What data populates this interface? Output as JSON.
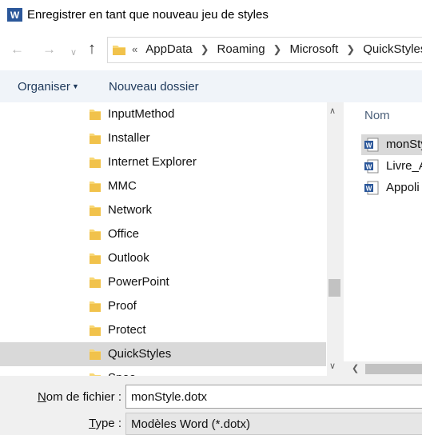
{
  "window": {
    "title": "Enregistrer en tant que nouveau jeu de styles",
    "app_icon": "word-icon"
  },
  "nav": {
    "back_icon": "arrow-left-icon",
    "forward_icon": "arrow-right-icon",
    "history_icon": "chevron-down-icon",
    "up_icon": "arrow-up-icon"
  },
  "address": {
    "overflow_marker": "«",
    "breadcrumbs": [
      "AppData",
      "Roaming",
      "Microsoft",
      "QuickStyles"
    ]
  },
  "toolbar": {
    "organise_label": "Organiser",
    "new_folder_label": "Nouveau dossier"
  },
  "tree": {
    "items": [
      {
        "label": "InputMethod"
      },
      {
        "label": "Installer"
      },
      {
        "label": "Internet Explorer"
      },
      {
        "label": "MMC"
      },
      {
        "label": "Network"
      },
      {
        "label": "Office"
      },
      {
        "label": "Outlook"
      },
      {
        "label": "PowerPoint"
      },
      {
        "label": "Proof"
      },
      {
        "label": "Protect"
      },
      {
        "label": "QuickStyles",
        "selected": true
      },
      {
        "label": "Spee"
      }
    ]
  },
  "files": {
    "column_name": "Nom",
    "items": [
      {
        "label": "monSty",
        "selected": true
      },
      {
        "label": "Livre_A"
      },
      {
        "label": "Appoli"
      }
    ]
  },
  "form": {
    "filename_label_prefix": "N",
    "filename_label_rest": "om de fichier :",
    "filename_value": "monStyle.dotx",
    "type_label_prefix": "T",
    "type_label_rest": "ype :",
    "type_value": "Modèles Word (*.dotx)"
  },
  "colors": {
    "folder_yellow": "#f8d775",
    "word_blue": "#2b579a",
    "toolbar_bg": "#f0f4f9",
    "selection": "#d9d9d9"
  }
}
